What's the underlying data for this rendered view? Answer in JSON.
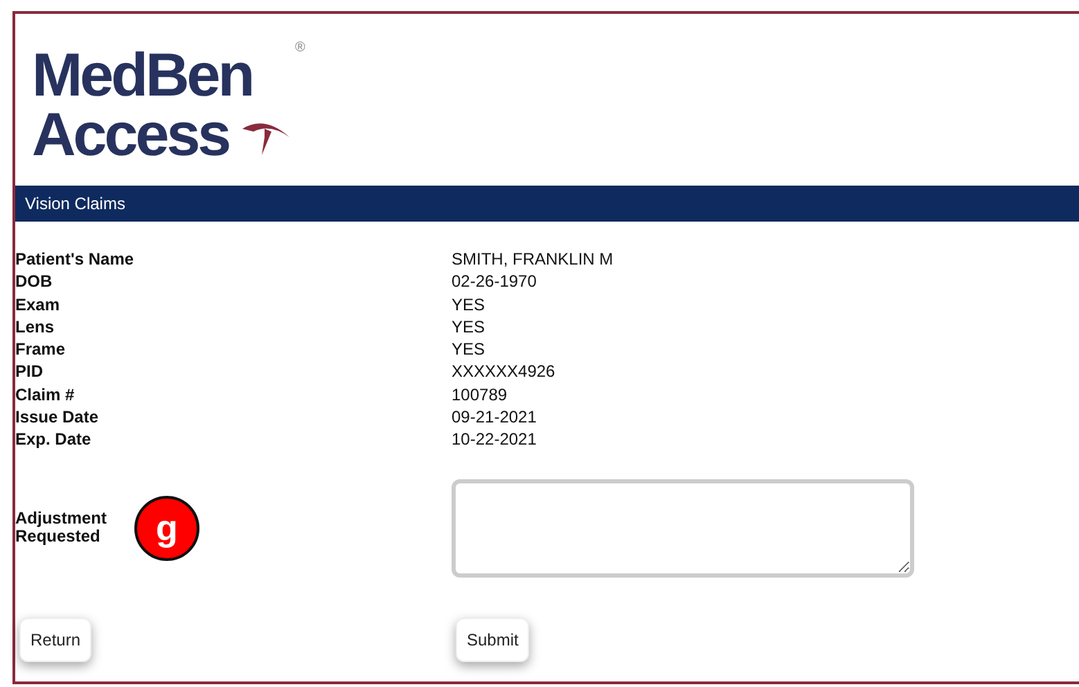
{
  "logo": {
    "line_1": "MedBen",
    "registered": "®",
    "line_2": "Access"
  },
  "header": {
    "title": "Vision Claims"
  },
  "fields": [
    {
      "label": "Patient's Name",
      "value": "SMITH, FRANKLIN M"
    },
    {
      "label": "DOB",
      "value": "02-26-1970"
    },
    {
      "label": "Exam",
      "value": "YES"
    },
    {
      "label": "Lens",
      "value": "YES"
    },
    {
      "label": "Frame",
      "value": "YES"
    },
    {
      "label": "PID",
      "value": "XXXXXX4926"
    },
    {
      "label": "Claim #",
      "value": "100789"
    },
    {
      "label": "Issue Date",
      "value": "09-21-2021"
    },
    {
      "label": "Exp. Date",
      "value": "10-22-2021"
    }
  ],
  "adjustment": {
    "label_line_1": "Adjustment",
    "label_line_2": "Requested",
    "marker": "g"
  },
  "buttons": [
    "Return",
    "Submit"
  ]
}
